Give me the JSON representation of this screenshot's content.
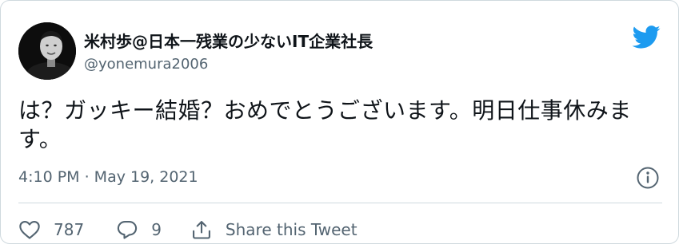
{
  "tweet": {
    "display_name": "米村歩@日本一残業の少ないIT企業社長",
    "handle": "@yonemura2006",
    "text": "は？ガッキー結婚？おめでとうございます。明日仕事休みます。",
    "timestamp": "4:10 PM · May 19, 2021",
    "avatar": "avatar-photo",
    "brand_icon": "twitter-bird-icon",
    "brand_color": "#1d9bf0"
  },
  "actions": {
    "like_count": "787",
    "reply_count": "9",
    "share_label": "Share this Tweet"
  },
  "colors": {
    "text": "#0f1419",
    "secondary": "#536471",
    "border": "#cfd9de"
  }
}
